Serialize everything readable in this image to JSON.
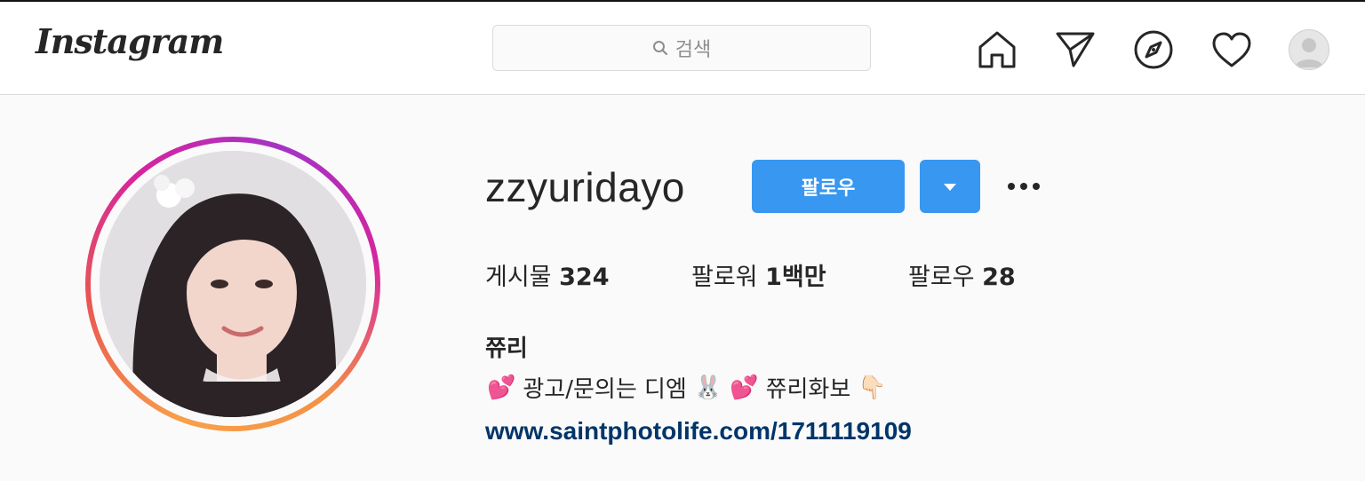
{
  "nav": {
    "logo": "Instagram",
    "search_placeholder": "검색",
    "icons": [
      "home-icon",
      "direct-message-icon",
      "explore-icon",
      "activity-heart-icon",
      "profile-avatar"
    ]
  },
  "profile": {
    "username": "zzyuridayo",
    "follow_label": "팔로우",
    "stats": {
      "posts_label": "게시물",
      "posts_value": "324",
      "followers_label": "팔로워",
      "followers_value": "1백만",
      "following_label": "팔로우",
      "following_value": "28"
    },
    "full_name": "쮸리",
    "bio": {
      "part1": "광고/문의는 디엠",
      "part2": "쮸리화보",
      "emoji_hearts": "💕",
      "emoji_rabbit": "🐰",
      "emoji_point": "👇🏻"
    },
    "link": "www.saintphotolife.com/1711119109"
  },
  "colors": {
    "accent": "#3897f0",
    "link": "#003569",
    "background": "#fafafa"
  }
}
